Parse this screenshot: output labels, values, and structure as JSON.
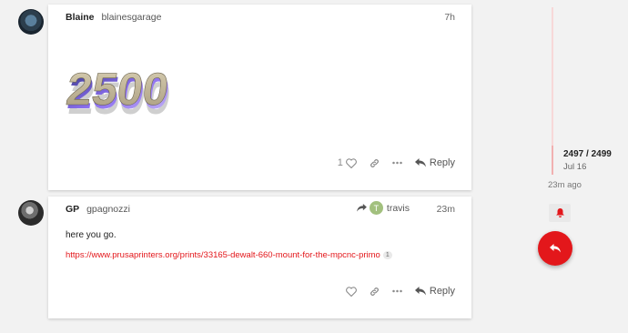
{
  "posts": [
    {
      "username": "Blaine",
      "fullname": "blainesgarage",
      "age": "7h",
      "image_text": "2500",
      "likes": "1",
      "reply_label": "Reply"
    },
    {
      "username": "GP",
      "fullname": "gpagnozzi",
      "age": "23m",
      "reply_to_initial": "T",
      "reply_to_user": "travis",
      "body": "here you go.",
      "link": "https://www.prusaprinters.org/prints/33165-dewalt-660-mount-for-the-mpcnc-primo",
      "link_clicks": "1",
      "reply_label": "Reply"
    }
  ],
  "timeline": {
    "counter": "2497 / 2499",
    "date": "Jul 16",
    "last_activity": "23m ago",
    "progress": 0.999
  },
  "icons": {
    "like": "heart-icon",
    "link": "link-icon",
    "more": "ellipsis-icon",
    "reply": "reply-arrow-icon",
    "notifications": "bell-icon"
  },
  "colors": {
    "accent": "#e3171b",
    "timeline_track": "#f7d8d8",
    "timeline_handle": "#f1b1b1"
  }
}
